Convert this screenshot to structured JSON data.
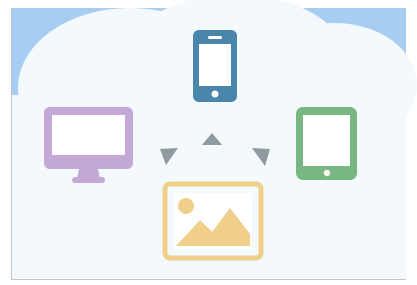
{
  "illustration": {
    "icons": [
      {
        "name": "monitor-icon",
        "color": "#c4a8d6"
      },
      {
        "name": "smartphone-icon",
        "color": "#4a86ab"
      },
      {
        "name": "tablet-icon",
        "color": "#79b782"
      },
      {
        "name": "image-icon",
        "color": "#efcf8a"
      }
    ],
    "arrows": [
      {
        "name": "arrow-up-icon",
        "color": "#8f9a9e"
      },
      {
        "name": "arrow-left-icon",
        "color": "#8f9a9e"
      },
      {
        "name": "arrow-right-icon",
        "color": "#8f9a9e"
      }
    ],
    "colors": {
      "sky": "#a7cdf3",
      "cloud": "#f3f9fc",
      "frame_border": "#c5c5c5",
      "screen_fill": "#ffffff"
    }
  }
}
